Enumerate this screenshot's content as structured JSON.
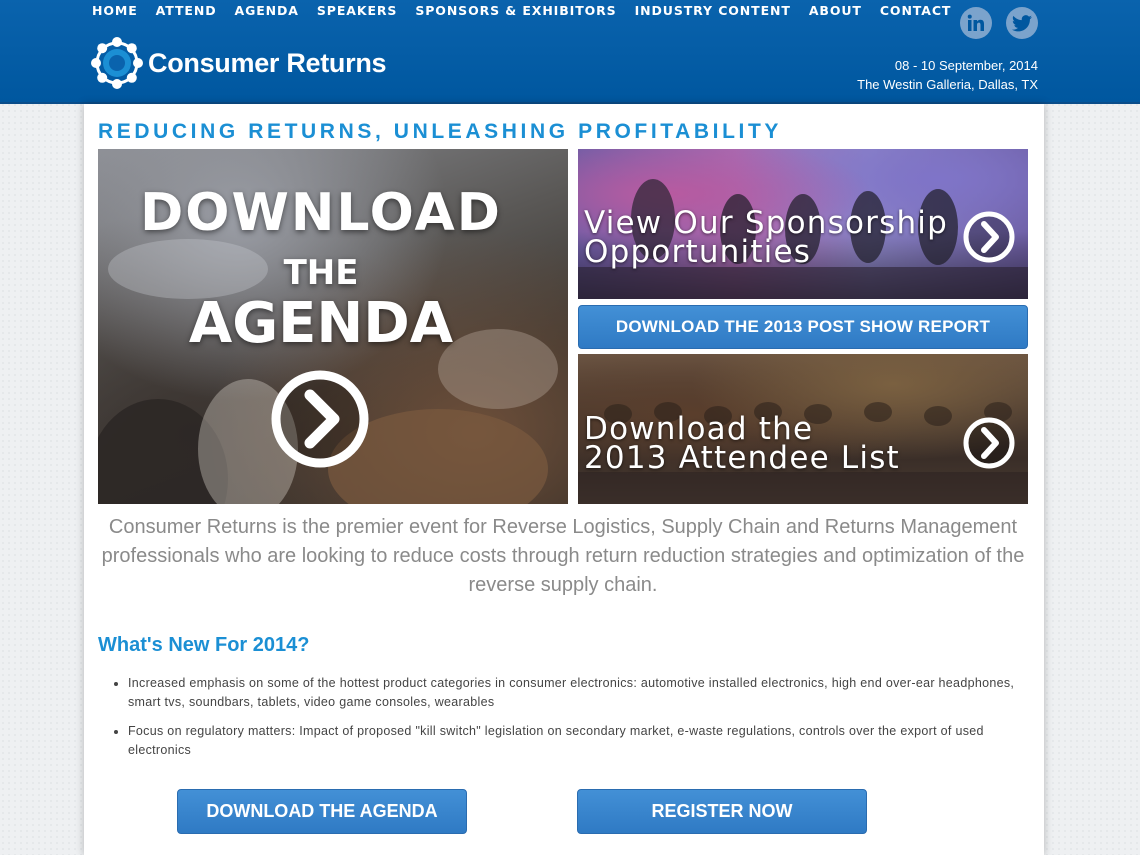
{
  "nav": {
    "items": [
      "HOME",
      "ATTEND",
      "AGENDA",
      "SPEAKERS",
      "SPONSORS & EXHIBITORS",
      "INDUSTRY CONTENT",
      "ABOUT",
      "CONTACT"
    ]
  },
  "social": {
    "icons": [
      "linkedin-icon",
      "twitter-icon"
    ]
  },
  "brand": {
    "name": "Consumer Returns"
  },
  "event": {
    "dates": "08 - 10 September, 2014",
    "venue": "The Westin Galleria, Dallas, TX"
  },
  "main": {
    "tagline": "REDUCING RETURNS, UNLEASHING PROFITABILITY",
    "hero_left": {
      "line1": "DOWNLOAD",
      "line2": "THE",
      "line3": "AGENDA"
    },
    "card_sponsorship": {
      "line1": "View Our Sponsorship",
      "line2": "Opportunities"
    },
    "report_button": "DOWNLOAD THE 2013 POST SHOW REPORT",
    "card_attendee": {
      "line1": "Download the",
      "line2": "2013 Attendee List"
    },
    "intro": "Consumer Returns is the premier event for Reverse Logistics, Supply Chain and Returns Management professionals who are looking to reduce costs through return reduction strategies and optimization of the reverse supply chain.",
    "whats_new_heading": "What's New For 2014?",
    "bullets": [
      "Increased emphasis on some of the hottest product categories in consumer electronics: automotive installed electronics, high end over-ear headphones, smart tvs, soundbars, tablets, video game consoles, wearables",
      "Focus on regulatory matters: Impact of proposed \"kill switch\" legislation on secondary market, e-waste regulations, controls over the export of used electronics"
    ],
    "agenda_button": "DOWNLOAD THE AGENDA",
    "register_button": "REGISTER NOW"
  },
  "colors": {
    "header_blue": "#00579f",
    "accent_blue": "#1b8fd4",
    "button_blue": "#3a86cf"
  }
}
